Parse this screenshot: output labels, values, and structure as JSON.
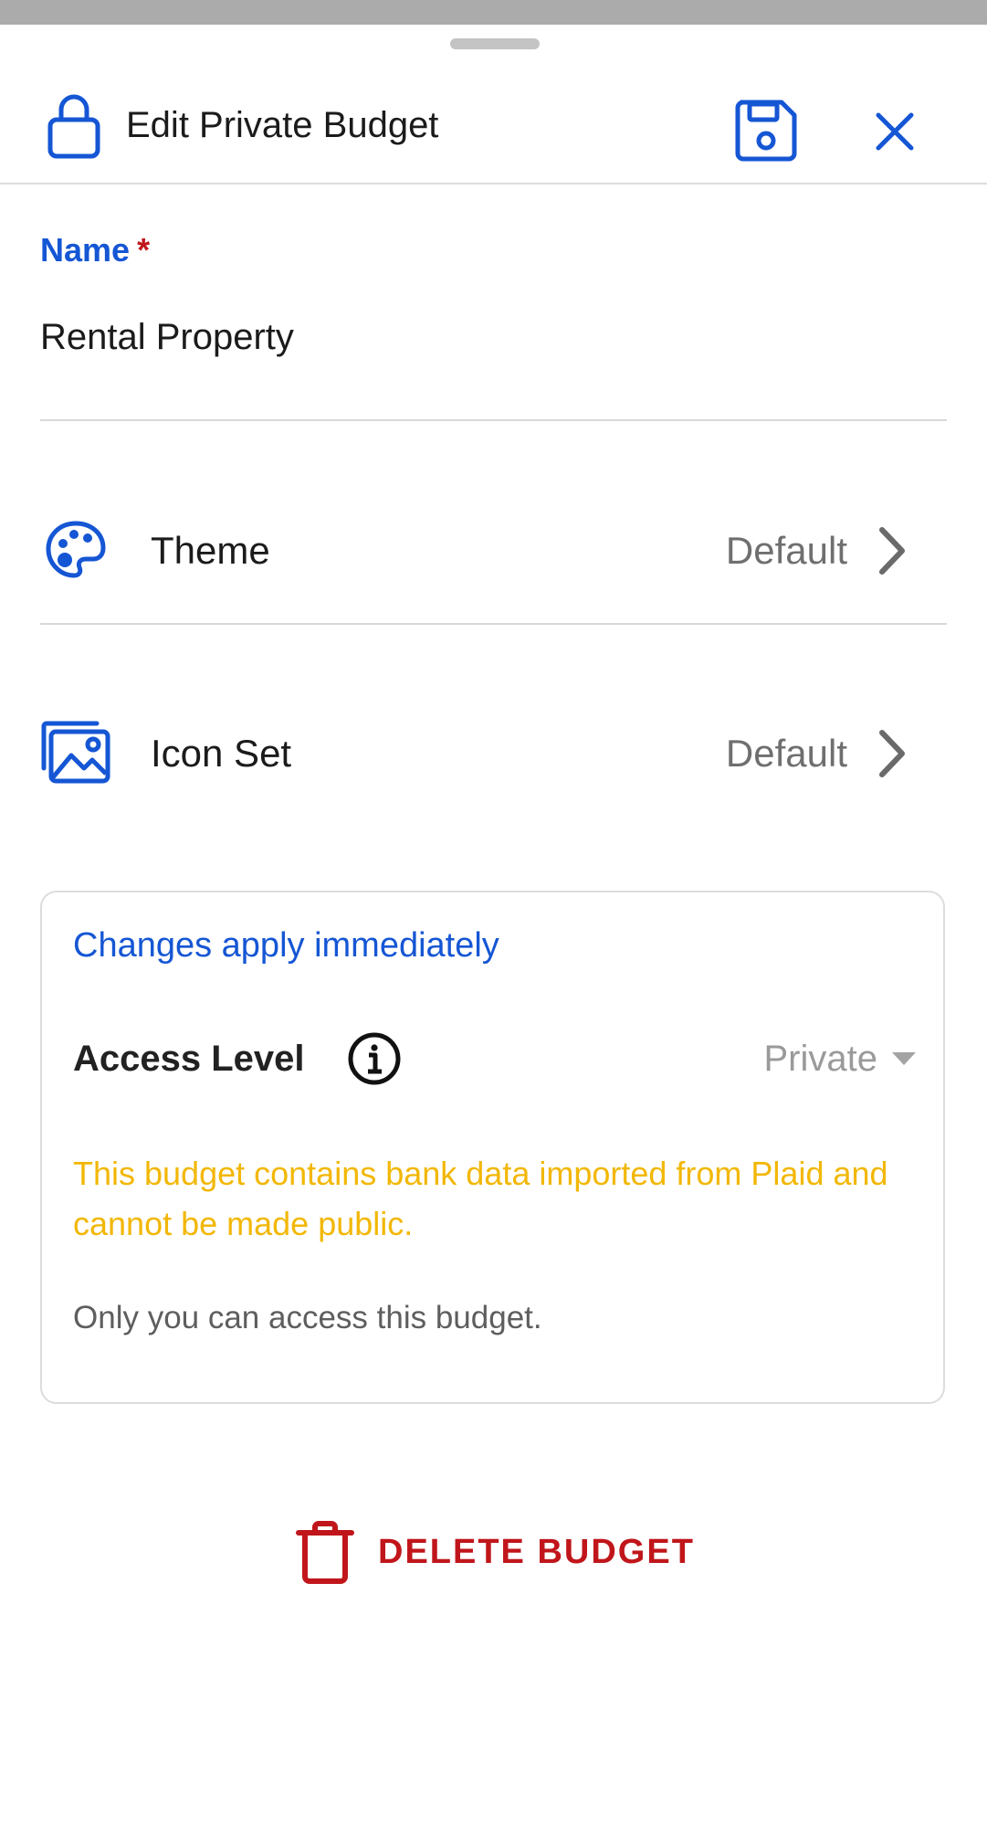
{
  "header": {
    "title": "Edit Private Budget"
  },
  "form": {
    "name_label": "Name",
    "required_marker": "*",
    "name_value": "Rental Property"
  },
  "settings": [
    {
      "label": "Theme",
      "value": "Default",
      "icon": "palette-icon"
    },
    {
      "label": "Icon Set",
      "value": "Default",
      "icon": "image-icon"
    }
  ],
  "access": {
    "changes_note": "Changes apply immediately",
    "label": "Access Level",
    "selected": "Private",
    "warning": "This budget contains bank data imported from Plaid and cannot be made public.",
    "description": "Only you can access this budget."
  },
  "actions": {
    "delete_label": "DELETE BUDGET"
  },
  "colors": {
    "accent": "#1556d4",
    "danger": "#c0161b",
    "warning": "#f2b705"
  }
}
